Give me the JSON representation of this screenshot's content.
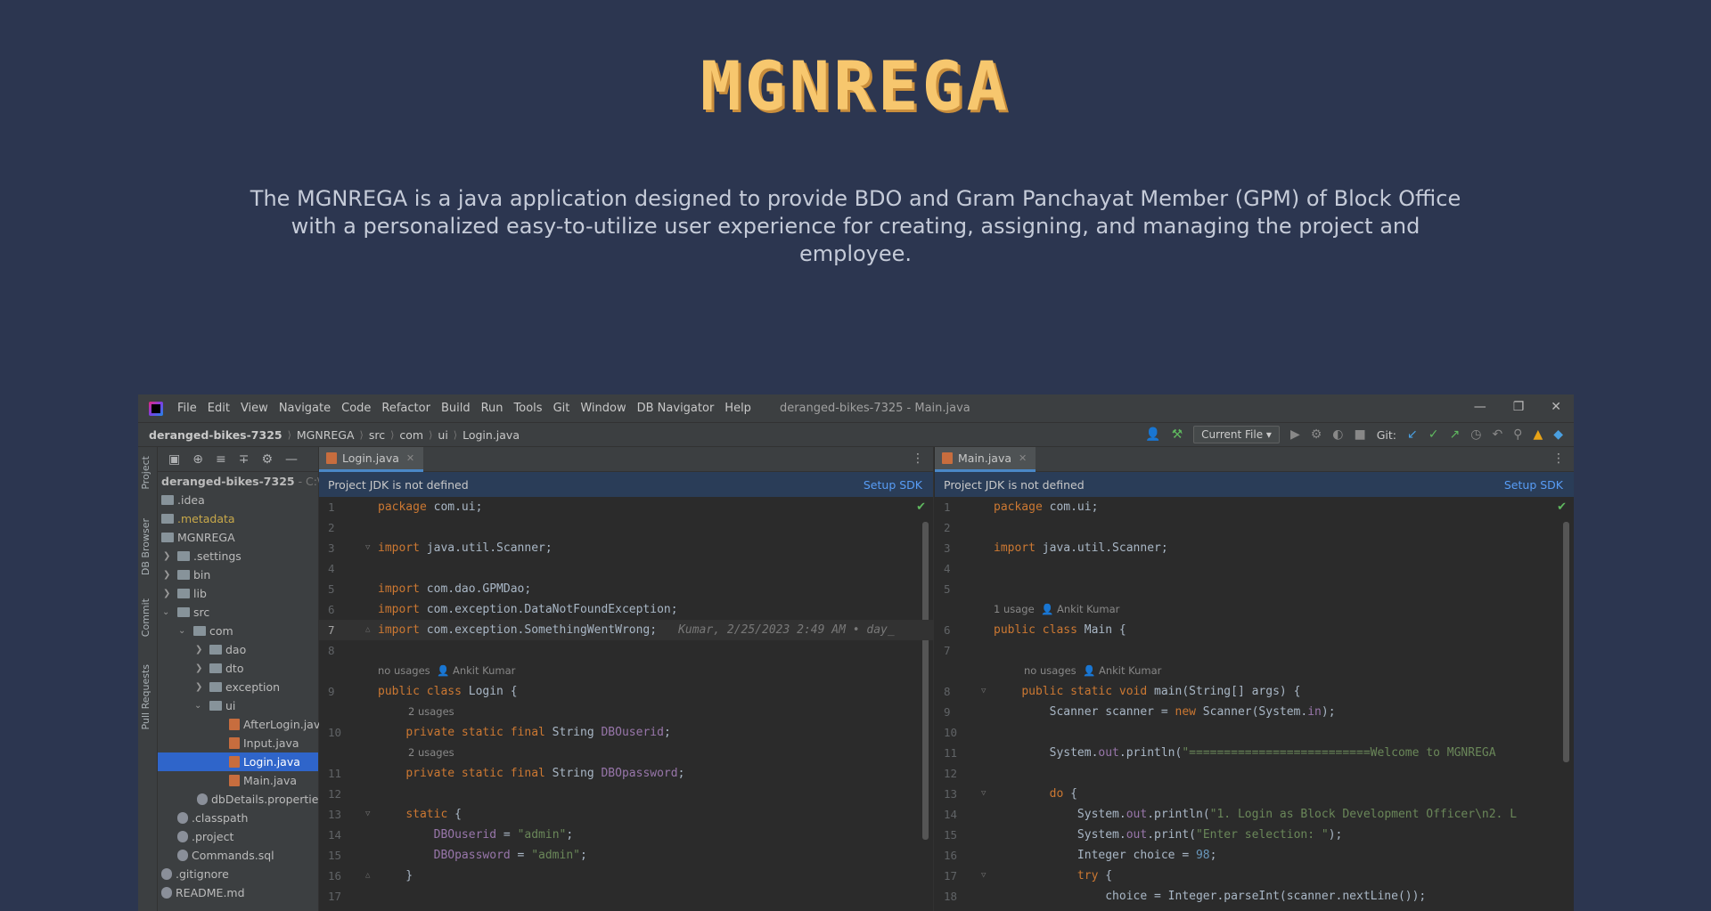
{
  "hero": {
    "title": "MGNREGA",
    "description": "The MGNREGA is a java application designed to provide BDO and Gram Panchayat Member (GPM) of Block Office with a personalized easy-to-utilize user experience for creating, assigning, and managing the project and employee."
  },
  "ide": {
    "menu": [
      "File",
      "Edit",
      "View",
      "Navigate",
      "Code",
      "Refactor",
      "Build",
      "Run",
      "Tools",
      "Git",
      "Window",
      "DB Navigator",
      "Help"
    ],
    "window_title": "deranged-bikes-7325 - Main.java",
    "breadcrumbs": [
      "deranged-bikes-7325",
      "MGNREGA",
      "src",
      "com",
      "ui",
      "Login.java"
    ],
    "run_config": "Current File",
    "git_label": "Git:",
    "side_tabs": [
      "Project",
      "DB Browser",
      "Commit",
      "Pull Requests"
    ],
    "project_root": "deranged-bikes-7325",
    "project_root_path": "- C:\\Us",
    "tree": [
      {
        "label": ".idea",
        "icon": "folder",
        "depth": 0
      },
      {
        "label": ".metadata",
        "icon": "folder",
        "depth": 0
      },
      {
        "label": "MGNREGA",
        "icon": "folder",
        "depth": 0
      },
      {
        "label": ".settings",
        "icon": "folder",
        "depth": 1
      },
      {
        "label": "bin",
        "icon": "folder",
        "depth": 1
      },
      {
        "label": "lib",
        "icon": "folder",
        "depth": 1
      },
      {
        "label": "src",
        "icon": "folder",
        "depth": 1
      },
      {
        "label": "com",
        "icon": "folder",
        "depth": 2
      },
      {
        "label": "dao",
        "icon": "folder",
        "depth": 3
      },
      {
        "label": "dto",
        "icon": "folder",
        "depth": 3
      },
      {
        "label": "exception",
        "icon": "folder",
        "depth": 3
      },
      {
        "label": "ui",
        "icon": "folder",
        "depth": 3
      },
      {
        "label": "AfterLogin.java",
        "icon": "java",
        "depth": 4
      },
      {
        "label": "Input.java",
        "icon": "java",
        "depth": 4
      },
      {
        "label": "Login.java",
        "icon": "java",
        "depth": 4,
        "selected": true
      },
      {
        "label": "Main.java",
        "icon": "java",
        "depth": 4
      },
      {
        "label": "dbDetails.properties",
        "icon": "file",
        "depth": 3
      },
      {
        "label": ".classpath",
        "icon": "file",
        "depth": 1
      },
      {
        "label": ".project",
        "icon": "file",
        "depth": 1
      },
      {
        "label": "Commands.sql",
        "icon": "file",
        "depth": 1
      },
      {
        "label": ".gitignore",
        "icon": "file",
        "depth": 0
      },
      {
        "label": "README.md",
        "icon": "file",
        "depth": 0
      }
    ],
    "left_editor": {
      "tab": "Login.java",
      "banner": "Project JDK is not defined",
      "setup": "Setup SDK"
    },
    "right_editor": {
      "tab": "Main.java",
      "banner": "Project JDK is not defined",
      "setup": "Setup SDK"
    },
    "hints": {
      "no_usages": "no usages",
      "one_usage": "1 usage",
      "two_usages": "2 usages",
      "author": "Ankit Kumar",
      "blame": "Kumar, 2/25/2023 2:49 AM • day_"
    }
  },
  "colors": {
    "background": "#2c3650",
    "title": "#f7c76e",
    "keyword": "#cc7832",
    "string": "#6a8759",
    "selection": "#2f65ca"
  }
}
